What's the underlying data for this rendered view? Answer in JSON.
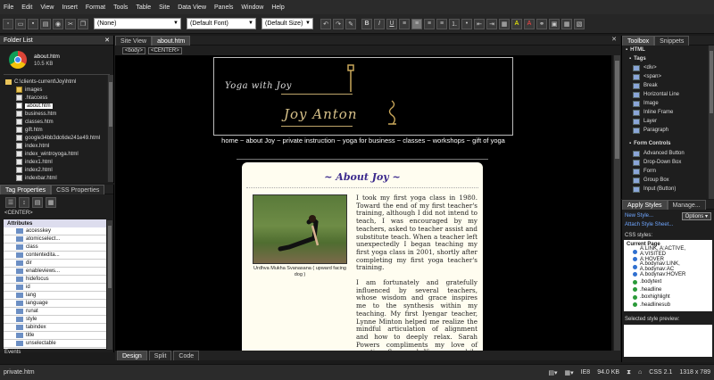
{
  "menu": [
    "File",
    "Edit",
    "View",
    "Insert",
    "Format",
    "Tools",
    "Table",
    "Site",
    "Data View",
    "Panels",
    "Window",
    "Help"
  ],
  "toolbar": {
    "style_select": "(None)",
    "font_select": "(Default Font)",
    "size_select": "(Default Size)"
  },
  "folder_list": {
    "title": "Folder List",
    "file_name": "about.htm",
    "file_size": "10.5 KB",
    "root": "C:\\clients-current\\Joy\\html",
    "items": [
      "images",
      ".htaccess",
      "about.htm",
      "business.htm",
      "classes.htm",
      "gift.htm",
      "google34bb3dc6de241e49.html",
      "index.html",
      "index_wintroyoga.html",
      "index1.html",
      "index2.html",
      "indexbar.html"
    ]
  },
  "tag_properties": {
    "tab1": "Tag Properties",
    "tab2": "CSS Properties",
    "element": "<CENTER>",
    "section": "Attributes",
    "attrs": [
      "accesskey",
      "atomicselect...",
      "class",
      "contentedita...",
      "dir",
      "enableviews...",
      "hidefocus",
      "id",
      "lang",
      "language",
      "runat",
      "style",
      "tabindex",
      "title",
      "unselectable",
      "visible"
    ],
    "footer": "Events"
  },
  "doc_tabs": {
    "site_view": "Site View",
    "about": "about.htm"
  },
  "quick_tags": [
    "<body>",
    "<CENTER>"
  ],
  "page": {
    "logo_title": "Yoga with Joy",
    "logo_name": "Joy Anton",
    "nav": "home ~ about Joy ~ private instruction ~ yoga for business ~ classes ~ workshops ~ gift of yoga",
    "heading": "~ About Joy ~",
    "caption": "Urdhva Mukha Svanasana ( upward facing dog )",
    "para1": "I took my first yoga class in 1980. Toward the end of my first teacher's training, although I did not intend to teach, I was encouraged by my teachers, asked to teacher assist and substitute teach. When a teacher left unexpectedly I began teaching my first yoga class in 2001, shortly after completing my first yoga teacher's training.",
    "para2": "I am fortunately and gratefully influenced by several teachers, whose wisdom and grace inspires me to the synthesis within my teaching. My first Iyengar teacher, Lynne Minton helped me realize the mindful articulation of alignment and how to deeply relax. Sarah Powers compliments my love of creative flow and Yin yoga while blending in"
  },
  "view_tabs": [
    "Design",
    "Split",
    "Code"
  ],
  "toolbox": {
    "tab1": "Toolbox",
    "tab2": "Snippets",
    "html": "HTML",
    "tags_header": "Tags",
    "tags": [
      "<div>",
      "<span>",
      "Break",
      "Horizontal Line",
      "Image",
      "Inline Frame",
      "Layer",
      "Paragraph"
    ],
    "form_header": "Form Controls",
    "forms": [
      "Advanced Button",
      "Drop-Down Box",
      "Form",
      "Group Box",
      "Input (Button)"
    ]
  },
  "apply_styles": {
    "tab1": "Apply Styles",
    "tab2": "Manage...",
    "new_style": "New Style...",
    "options": "Options",
    "attach": "Attach Style Sheet...",
    "css_label": "CSS styles:",
    "current": "Current Page",
    "styles": [
      "A:LINK, A:ACTIVE, A:VISITED",
      "A:HOVER",
      "A.bodynav:LINK, A.bodynav:AC",
      "A.bodynav:HOVER",
      ".bodytext",
      ".headline",
      ".boxhighlight",
      ".headlinesub"
    ],
    "preview": "Selected style preview:"
  },
  "status": {
    "file": "private.htm",
    "ie": "IE8",
    "size": "94.0 KB",
    "css": "CSS 2.1",
    "dims": "1318 x 789"
  },
  "colors": {
    "accent": "#1c4f9c",
    "heading": "#3c2a8c",
    "page_bg": "#000000",
    "content_bg": "#fffdf0"
  }
}
